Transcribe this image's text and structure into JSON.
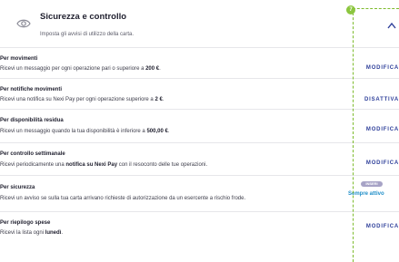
{
  "header": {
    "icon": "eye-icon",
    "title": "Sicurezza e controllo",
    "subtitle": "Imposta gli avvisi di utilizzo della carta.",
    "chevron_icon": "chevron-up-icon"
  },
  "marker": {
    "number": "7"
  },
  "rows": [
    {
      "title": "Per movimenti",
      "desc_before": "Ricevi un messaggio per ogni operazione pari o superiore a ",
      "desc_bold": "200 €",
      "desc_after": ".",
      "action": "MODIFICA"
    },
    {
      "title": "Per notifiche movimenti",
      "desc_before": "Ricevi una notifica su Nexi Pay per ogni operazione superiore a ",
      "desc_bold": "2 €",
      "desc_after": ".",
      "action": "DISATTIVA"
    },
    {
      "title": "Per disponibilità residua",
      "desc_before": "Ricevi un messaggio quando la tua disponibilità è inferiore a ",
      "desc_bold": "500,00 €",
      "desc_after": ".",
      "action": "MODIFICA"
    },
    {
      "title": "Per controllo settimanale",
      "desc_before": "Ricevi periodicamente una ",
      "desc_bold": "notifica su Nexi Pay",
      "desc_after": " con il resoconto delle tue operazioni.",
      "action": "MODIFICA"
    },
    {
      "title": "Per sicurezza",
      "desc_before": "Ricevi un avviso se sulla tua carta arrivano richieste di autorizzazione da un esercente a rischio frode.",
      "desc_bold": "",
      "desc_after": "",
      "badge": "INSERI",
      "status": "Sempre attivo"
    },
    {
      "title": "Per riepilogo spese",
      "desc_before": "Ricevi la lista ogni ",
      "desc_bold": "lunedì",
      "desc_after": ".",
      "action": "MODIFICA"
    }
  ]
}
